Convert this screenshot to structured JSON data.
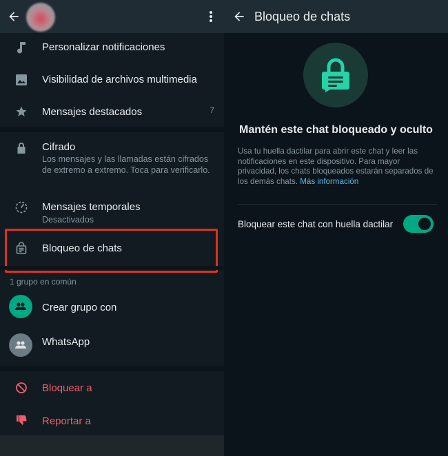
{
  "left": {
    "items": [
      {
        "label": "Personalizar notificaciones",
        "icon": "music-note-icon"
      },
      {
        "label": "Visibilidad de archivos multimedia",
        "icon": "image-icon"
      },
      {
        "label": "Mensajes destacados",
        "icon": "star-icon",
        "count": "7"
      },
      {
        "label": "Cifrado",
        "icon": "lock-icon",
        "subtitle": "Los mensajes y las llamadas están cifrados de extremo a extremo. Toca para verificarlo."
      },
      {
        "label": "Mensajes temporales",
        "icon": "timer-icon",
        "subtitle": "Desactivados"
      },
      {
        "label": "Bloqueo de chats",
        "icon": "chat-lock-icon"
      }
    ],
    "groups_title": "1 grupo en común",
    "groups": [
      {
        "label": "Crear grupo con",
        "icon": "group-add-icon"
      },
      {
        "label": "WhatsApp",
        "icon": "group-avatar-icon"
      }
    ],
    "actions": [
      {
        "label": "Bloquear a",
        "icon": "block-icon"
      },
      {
        "label": "Reportar a",
        "icon": "thumbs-down-icon"
      }
    ]
  },
  "right": {
    "title": "Bloqueo de chats",
    "headline": "Mantén este chat bloqueado y oculto",
    "description": "Usa tu huella dactilar para abrir este chat y leer las notificaciones en este dispositivo. Para mayor privacidad, los chats bloqueados estarán separados de los demás chats.",
    "more_info": "Más información",
    "toggle_label": "Bloquear este chat con huella dactilar",
    "toggle_on": true
  },
  "colors": {
    "accent": "#00a884",
    "danger": "#f15c6d",
    "highlight": "#e0301e",
    "link": "#53bdeb"
  }
}
